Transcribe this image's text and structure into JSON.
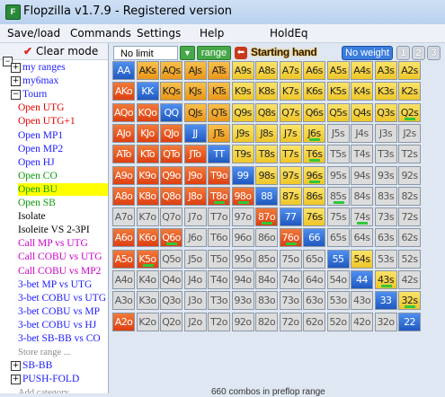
{
  "window": {
    "title": "Flopzilla v1.7.9 - Registered version"
  },
  "menu": {
    "items": [
      "Save/load",
      "Commands",
      "Settings",
      "Help",
      "HoldEq"
    ]
  },
  "sidebar": {
    "clear_mode_label": "Clear mode",
    "items": [
      {
        "label": "my ranges",
        "type": "group",
        "color": "#1a1aff"
      },
      {
        "label": "my6max",
        "type": "group",
        "color": "#1a1aff"
      },
      {
        "label": "Tourn",
        "type": "group-open",
        "color": "#1a1aff"
      },
      {
        "label": "Open UTG",
        "type": "leaf",
        "color": "#e60000"
      },
      {
        "label": "Open UTG+1",
        "type": "leaf",
        "color": "#e60000"
      },
      {
        "label": "Open MP1",
        "type": "leaf",
        "color": "#1a1aff"
      },
      {
        "label": "Open MP2",
        "type": "leaf",
        "color": "#1a1aff"
      },
      {
        "label": "Open HJ",
        "type": "leaf",
        "color": "#1a1aff"
      },
      {
        "label": "Open CO",
        "type": "leaf",
        "color": "#0a9a0a"
      },
      {
        "label": "Open BU",
        "type": "leaf-selected",
        "color": "#0a9a0a"
      },
      {
        "label": "Open SB",
        "type": "leaf",
        "color": "#0a9a0a"
      },
      {
        "label": "Isolate",
        "type": "leaf",
        "color": "#000000"
      },
      {
        "label": "Isoleite VS 2-3PI",
        "type": "leaf",
        "color": "#000000"
      },
      {
        "label": "Call MP vs UTG",
        "type": "leaf",
        "color": "#cc00cc"
      },
      {
        "label": "Call COBU vs UTG",
        "type": "leaf",
        "color": "#cc00cc"
      },
      {
        "label": "Call COBU vs MP2",
        "type": "leaf",
        "color": "#cc00cc"
      },
      {
        "label": "3-bet MP vs UTG",
        "type": "leaf",
        "color": "#1a1aff"
      },
      {
        "label": "3-bet COBU vs UTG",
        "type": "leaf",
        "color": "#1a1aff"
      },
      {
        "label": "3-bet COBU vs MP",
        "type": "leaf",
        "color": "#1a1aff"
      },
      {
        "label": "3-bet COBU vs HJ",
        "type": "leaf",
        "color": "#1a1aff"
      },
      {
        "label": "3-bet SB-BB vs CO",
        "type": "leaf",
        "color": "#1a1aff"
      },
      {
        "label": "Store range ...",
        "type": "action",
        "color": "#8a8a8a"
      },
      {
        "label": "SB-BB",
        "type": "group",
        "color": "#1a1aff"
      },
      {
        "label": "PUSH-FOLD",
        "type": "group",
        "color": "#1a1aff"
      },
      {
        "label": "Add category",
        "type": "action",
        "color": "#8a8a8a"
      }
    ]
  },
  "toolbar": {
    "mode_select": "No limit",
    "range_label": "range",
    "starting_hand_label": "Starting hand",
    "no_weight_label": "No weight",
    "weight_buttons": [
      "1",
      "2",
      "3"
    ]
  },
  "colors": {
    "pair_blue": "#2f6fd6",
    "selected_red": "#e8551f",
    "selected_orange": "#f3a51f",
    "selected_yellow": "#f3d23b",
    "unselected": "#dcdcdc",
    "partial_bar": "#2fc83a"
  },
  "grid": {
    "rows": [
      [
        "AA",
        "AKs",
        "AQs",
        "AJs",
        "ATs",
        "A9s",
        "A8s",
        "A7s",
        "A6s",
        "A5s",
        "A4s",
        "A3s",
        "A2s"
      ],
      [
        "AKo",
        "KK",
        "KQs",
        "KJs",
        "KTs",
        "K9s",
        "K8s",
        "K7s",
        "K6s",
        "K5s",
        "K4s",
        "K3s",
        "K2s"
      ],
      [
        "AQo",
        "KQo",
        "QQ",
        "QJs",
        "QTs",
        "Q9s",
        "Q8s",
        "Q7s",
        "Q6s",
        "Q5s",
        "Q4s",
        "Q3s",
        "Q2s"
      ],
      [
        "AJo",
        "KJo",
        "QJo",
        "JJ",
        "JTs",
        "J9s",
        "J8s",
        "J7s",
        "J6s",
        "J5s",
        "J4s",
        "J3s",
        "J2s"
      ],
      [
        "ATo",
        "KTo",
        "QTo",
        "JTo",
        "TT",
        "T9s",
        "T8s",
        "T7s",
        "T6s",
        "T5s",
        "T4s",
        "T3s",
        "T2s"
      ],
      [
        "A9o",
        "K9o",
        "Q9o",
        "J9o",
        "T9o",
        "99",
        "98s",
        "97s",
        "96s",
        "95s",
        "94s",
        "93s",
        "92s"
      ],
      [
        "A8o",
        "K8o",
        "Q8o",
        "J8o",
        "T8o",
        "98o",
        "88",
        "87s",
        "86s",
        "85s",
        "84s",
        "83s",
        "82s"
      ],
      [
        "A7o",
        "K7o",
        "Q7o",
        "J7o",
        "T7o",
        "97o",
        "87o",
        "77",
        "76s",
        "75s",
        "74s",
        "73s",
        "72s"
      ],
      [
        "A6o",
        "K6o",
        "Q6o",
        "J6o",
        "T6o",
        "96o",
        "86o",
        "76o",
        "66",
        "65s",
        "64s",
        "63s",
        "62s"
      ],
      [
        "A5o",
        "K5o",
        "Q5o",
        "J5o",
        "T5o",
        "95o",
        "85o",
        "75o",
        "65o",
        "55",
        "54s",
        "53s",
        "52s"
      ],
      [
        "A4o",
        "K4o",
        "Q4o",
        "J4o",
        "T4o",
        "94o",
        "84o",
        "74o",
        "64o",
        "54o",
        "44",
        "43s",
        "42s"
      ],
      [
        "A3o",
        "K3o",
        "Q3o",
        "J3o",
        "T3o",
        "93o",
        "83o",
        "73o",
        "63o",
        "53o",
        "43o",
        "33",
        "32s"
      ],
      [
        "A2o",
        "K2o",
        "Q2o",
        "J2o",
        "T2o",
        "92o",
        "82o",
        "72o",
        "62o",
        "52o",
        "42o",
        "32o",
        "22"
      ]
    ],
    "fills": [
      "PYYYYYYYYYYYY",
      "RPYYYYYYYYYYY",
      "RRPYYYYYYYYYY",
      "RRRPYYYYYGGGG",
      "RRRRPYYYYGGGG",
      "RRRRRPYYYGGGG",
      "RRRRRRPYYGGGG",
      "GGGGGGRPYGGGG",
      "RRRGGGGRPGGGG",
      "RRGGGGGGGPYGG",
      "GGGGGGGGGGPYG",
      "GGGGGGGGGGGPY",
      "RGGGGGGGGGGGP"
    ],
    "partial": [
      [
        0,
        "YYYYYYYYYYYYY"
      ],
      [
        1,
        "RYYYYYYYYYYYY"
      ]
    ]
  },
  "status": {
    "text": "660 combos in preflop range"
  }
}
